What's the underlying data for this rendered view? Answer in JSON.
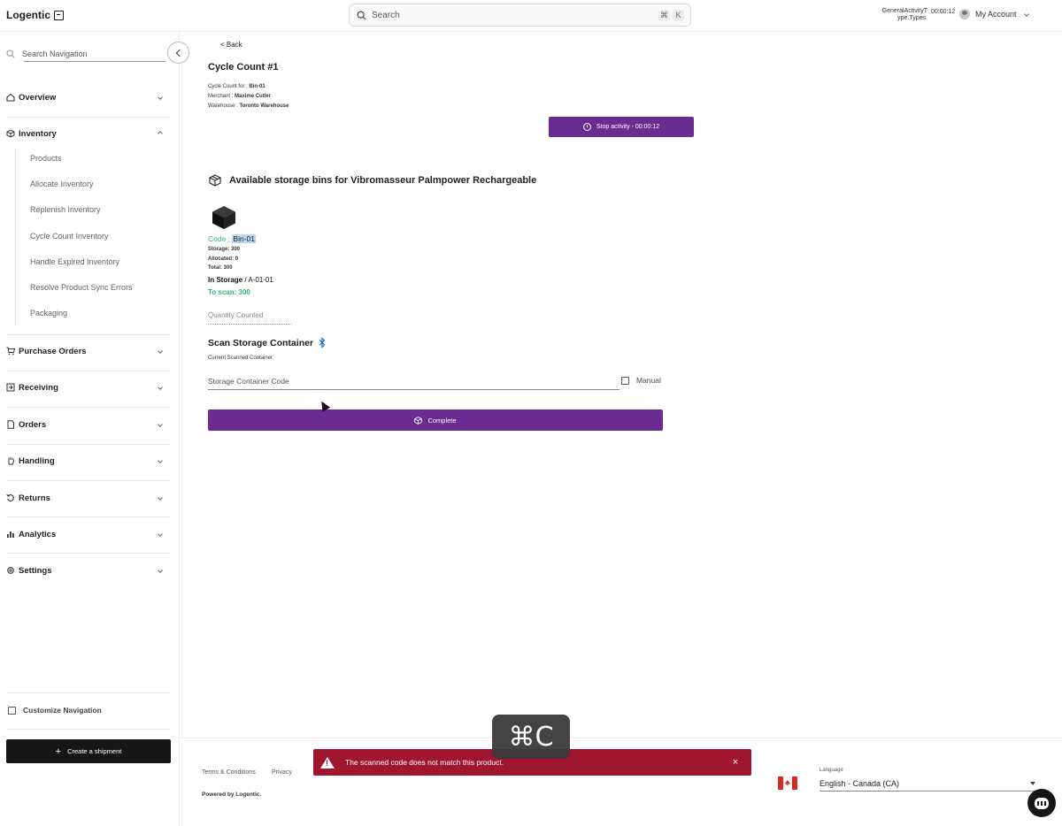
{
  "header": {
    "logo": "Logentic",
    "search_placeholder": "Search",
    "kbd_cmd": "⌘",
    "kbd_k": "K",
    "activity_label_1": "GeneralActivityT",
    "activity_label_2": "ype.Types.",
    "activity_timer": "00:00:12",
    "account_label": "My Account"
  },
  "sidebar": {
    "search_placeholder": "Search Navigation",
    "sections": {
      "overview": "Overview",
      "inventory": "Inventory",
      "purchase_orders": "Purchase Orders",
      "receiving": "Receiving",
      "orders": "Orders",
      "handling": "Handling",
      "returns": "Returns",
      "analytics": "Analytics",
      "settings": "Settings"
    },
    "inventory_items": [
      "Products",
      "Allocate Inventory",
      "Replenish Inventory",
      "Cycle Count Inventory",
      "Handle Expired Inventory",
      "Resolve Product Sync Errors",
      "Packaging"
    ],
    "customize_label": "Customize Navigation",
    "create_button": "Create a shipment"
  },
  "main": {
    "back": "< Back",
    "title": "Cycle Count #1",
    "meta": {
      "cycle_for_label": "Cycle Count for :",
      "cycle_for_value": "Bin-01",
      "merchant_label": "Merchant :",
      "merchant_value": "Maxime Cutler",
      "warehouse_label": "Warehouse :",
      "warehouse_value": "Toronto Warehouse"
    },
    "stop_button": "Stop activity - 00:00:12",
    "bins_heading": "Available storage bins for Vibromasseur Palmpower Rechargeable",
    "bin": {
      "code_label": "Code :",
      "code_value": "Bin-01",
      "storage": "Storage: 300",
      "allocated": "Allocated: 0",
      "total": "Total: 300",
      "location_prefix": "In Storage",
      "location_suffix": "/ A-01-01",
      "to_scan": "To scan: 300"
    },
    "quantity_placeholder": "Quantity Counted",
    "scan_heading": "Scan Storage Container",
    "current_scanned_label": "Current Scanned Container:",
    "container_placeholder": "Storage Container Code",
    "manual_label": "Manual",
    "complete_button": "Complete"
  },
  "footer": {
    "terms": "Terms & Conditions",
    "privacy": "Privacy",
    "powered": "Powered by Logentic.",
    "language_label": "Language",
    "language_value": "English - Canada (CA)"
  },
  "toast": {
    "message": "The scanned code does not match this product.",
    "close": "×"
  },
  "keyboard_overlay": "⌘C",
  "colors": {
    "accent": "#6b2c91",
    "success": "#2bb673",
    "error": "#a1162f"
  }
}
